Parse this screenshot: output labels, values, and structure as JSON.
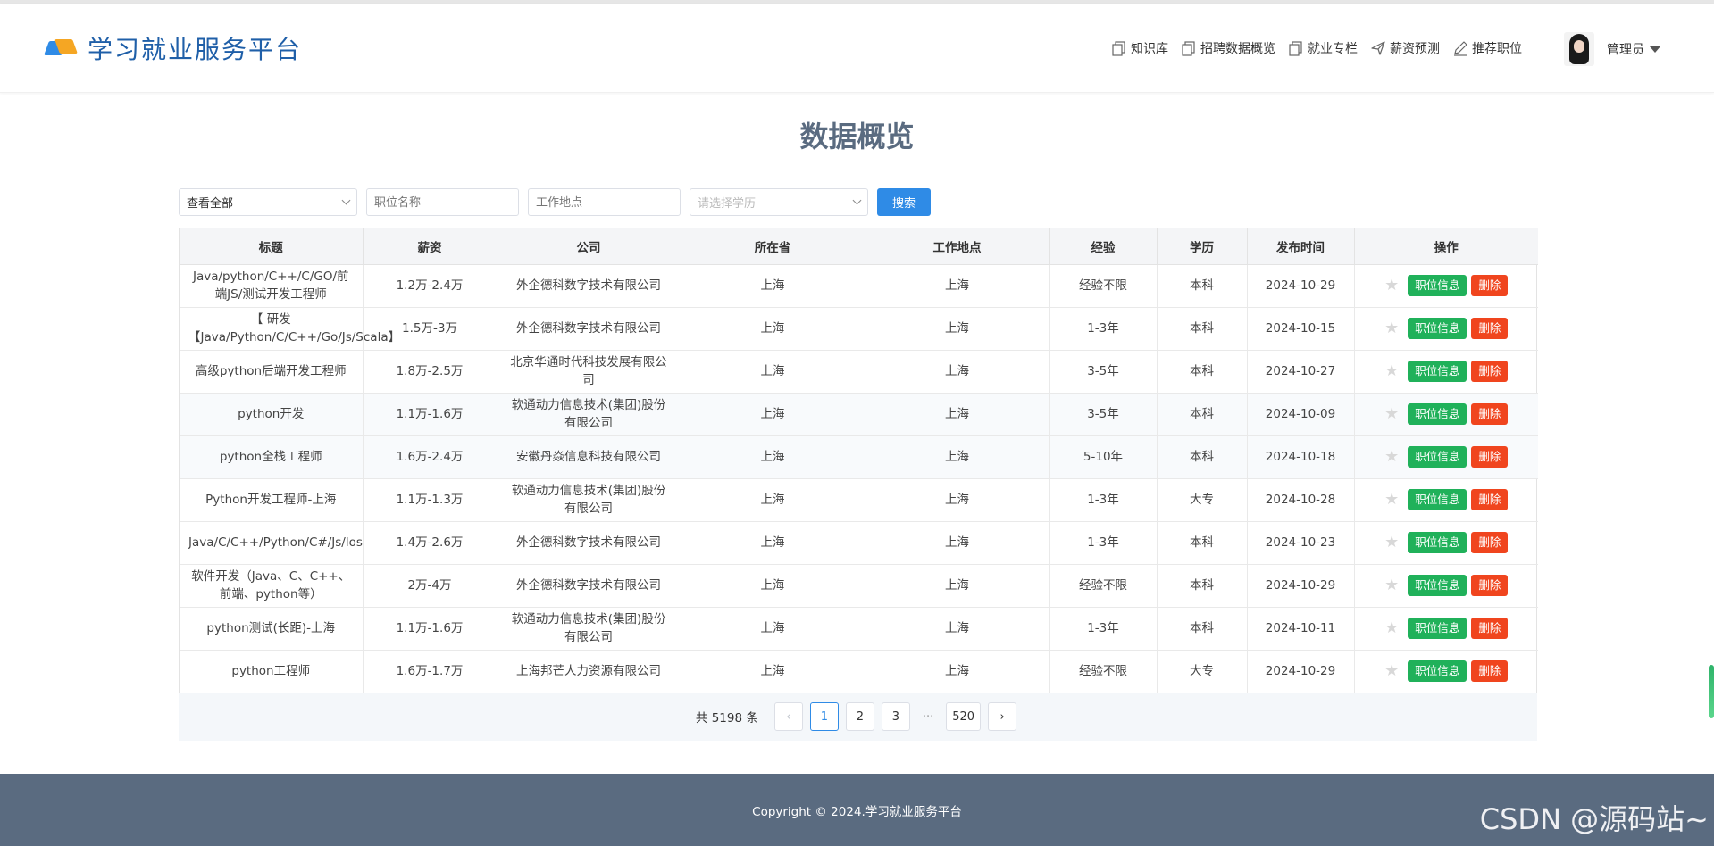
{
  "app": {
    "title": "学习就业服务平台"
  },
  "nav": [
    {
      "label": "知识库",
      "icon": "copy-icon"
    },
    {
      "label": "招聘数据概览",
      "icon": "copy-icon"
    },
    {
      "label": "就业专栏",
      "icon": "copy-icon"
    },
    {
      "label": "薪资预测",
      "icon": "send-icon"
    },
    {
      "label": "推荐职位",
      "icon": "pen-icon"
    }
  ],
  "user": {
    "name": "管理员"
  },
  "page": {
    "title": "数据概览"
  },
  "filters": {
    "role_value": "查看全部",
    "title_placeholder": "职位名称",
    "location_placeholder": "工作地点",
    "education_placeholder": "请选择学历",
    "search_label": "搜索"
  },
  "table": {
    "headers": [
      "标题",
      "薪资",
      "公司",
      "所在省",
      "工作地点",
      "经验",
      "学历",
      "发布时间",
      "操作"
    ],
    "rows": [
      {
        "title": "Java/python/C++/C/GO/前端JS/测试开发工程师",
        "salary": "1.2万-2.4万",
        "company": "外企德科数字技术有限公司",
        "province": "上海",
        "location": "上海",
        "experience": "经验不限",
        "education": "本科",
        "date": "2024-10-29"
      },
      {
        "title": "【 研发【Java/Python/C/C++/Go/Js/Scala】",
        "salary": "1.5万-3万",
        "company": "外企德科数字技术有限公司",
        "province": "上海",
        "location": "上海",
        "experience": "1-3年",
        "education": "本科",
        "date": "2024-10-15"
      },
      {
        "title": "高级python后端开发工程师",
        "salary": "1.8万-2.5万",
        "company": "北京华通时代科技发展有限公司",
        "province": "上海",
        "location": "上海",
        "experience": "3-5年",
        "education": "本科",
        "date": "2024-10-27"
      },
      {
        "title": "python开发",
        "salary": "1.1万-1.6万",
        "company": "软通动力信息技术(集团)股份有限公司",
        "province": "上海",
        "location": "上海",
        "experience": "3-5年",
        "education": "本科",
        "date": "2024-10-09"
      },
      {
        "title": "python全栈工程师",
        "salary": "1.6万-2.4万",
        "company": "安徽丹焱信息科技有限公司",
        "province": "上海",
        "location": "上海",
        "experience": "5-10年",
        "education": "本科",
        "date": "2024-10-18"
      },
      {
        "title": "Python开发工程师-上海",
        "salary": "1.1万-1.3万",
        "company": "软通动力信息技术(集团)股份有限公司",
        "province": "上海",
        "location": "上海",
        "experience": "1-3年",
        "education": "大专",
        "date": "2024-10-28"
      },
      {
        "title": "Java/C/C++/Python/C#/Js/los",
        "salary": "1.4万-2.6万",
        "company": "外企德科数字技术有限公司",
        "province": "上海",
        "location": "上海",
        "experience": "1-3年",
        "education": "本科",
        "date": "2024-10-23"
      },
      {
        "title": "软件开发（Java、C、C++、前端、python等）",
        "salary": "2万-4万",
        "company": "外企德科数字技术有限公司",
        "province": "上海",
        "location": "上海",
        "experience": "经验不限",
        "education": "本科",
        "date": "2024-10-29"
      },
      {
        "title": "python测试(长距)-上海",
        "salary": "1.1万-1.6万",
        "company": "软通动力信息技术(集团)股份有限公司",
        "province": "上海",
        "location": "上海",
        "experience": "1-3年",
        "education": "本科",
        "date": "2024-10-11"
      },
      {
        "title": "python工程师",
        "salary": "1.6万-1.7万",
        "company": "上海邦芒人力资源有限公司",
        "province": "上海",
        "location": "上海",
        "experience": "经验不限",
        "education": "大专",
        "date": "2024-10-29"
      }
    ],
    "info_label": "职位信息",
    "delete_label": "删除",
    "star_glyph": "★"
  },
  "pagination": {
    "total_text": "共 5198 条",
    "prev": "‹",
    "next": "›",
    "pages": [
      "1",
      "2",
      "3"
    ],
    "ellipsis": "···",
    "last": "520",
    "current": "1"
  },
  "footer": {
    "copyright": "Copyright © 2024.学习就业服务平台",
    "watermark": "CSDN @源码站~"
  },
  "colors": {
    "primary": "#2f8be6",
    "success": "#20b15a",
    "danger": "#f0451e",
    "footer_bg": "#5a6b80",
    "title": "#5a6b80"
  }
}
